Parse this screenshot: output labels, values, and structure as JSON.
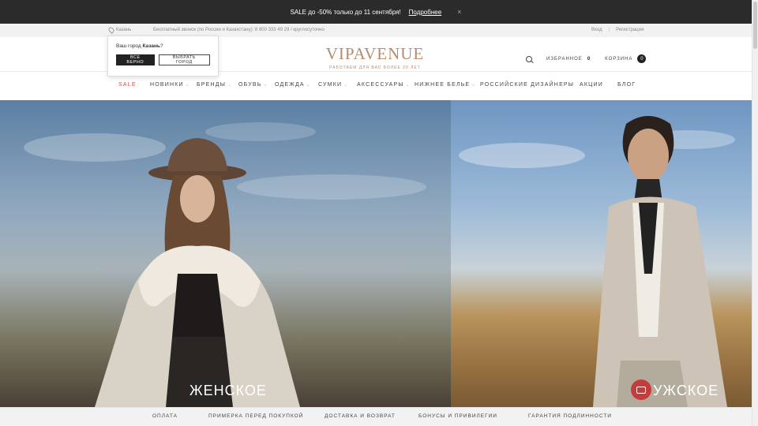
{
  "promo": {
    "text": "SALE до -50% только до 11 сентября!",
    "link": "Подробнее",
    "close": "×"
  },
  "util": {
    "city": "Казань",
    "phone": "Бесплатный звонок (по России и Казахстану): 8 800 333 49 29 / круглосуточно",
    "login": "Вход",
    "sep": "|",
    "register": "Регистрация"
  },
  "city_popup": {
    "question_prefix": "Ваш город ",
    "city": "Казань",
    "question_suffix": "?",
    "confirm": "ВСЕ ВЕРНО",
    "choose": "ВЫБРАТЬ ГОРОД"
  },
  "header": {
    "logo": "VIPAVENUE",
    "tagline": "РАБОТАЕМ ДЛЯ ВАС БОЛЕЕ 20 ЛЕТ",
    "favorites": "ИЗБРАННОЕ",
    "favorites_count": "0",
    "cart": "КОРЗИНА",
    "cart_count": "0"
  },
  "nav": [
    {
      "label": "SALE",
      "chev": false
    },
    {
      "label": "НОВИНКИ",
      "chev": true
    },
    {
      "label": "БРЕНДЫ",
      "chev": true
    },
    {
      "label": "ОБУВЬ",
      "chev": true
    },
    {
      "label": "ОДЕЖДА",
      "chev": true
    },
    {
      "label": "СУМКИ",
      "chev": true
    },
    {
      "label": "АКСЕССУАРЫ",
      "chev": true
    },
    {
      "label": "НИЖНЕЕ БЕЛЬЕ",
      "chev": true
    },
    {
      "label": "РОССИЙСКИЕ ДИЗАЙНЕРЫ",
      "chev": false
    },
    {
      "label": "АКЦИИ",
      "chev": false
    },
    {
      "label": "БЛОГ",
      "chev": false
    }
  ],
  "hero": {
    "women": "ЖЕНСКОЕ",
    "men": "УЖСКОЕ"
  },
  "footer": [
    "ОПЛАТА",
    "ПРИМЕРКА ПЕРЕД ПОКУПКОЙ",
    "ДОСТАВКА И ВОЗВРАТ",
    "БОНУСЫ И ПРИВИЛЕГИИ",
    "ГАРАНТИЯ ПОДЛИННОСТИ"
  ],
  "icons": {
    "search": "search-icon",
    "pin": "location-pin-icon",
    "chat": "chat-icon",
    "close": "close-icon"
  }
}
